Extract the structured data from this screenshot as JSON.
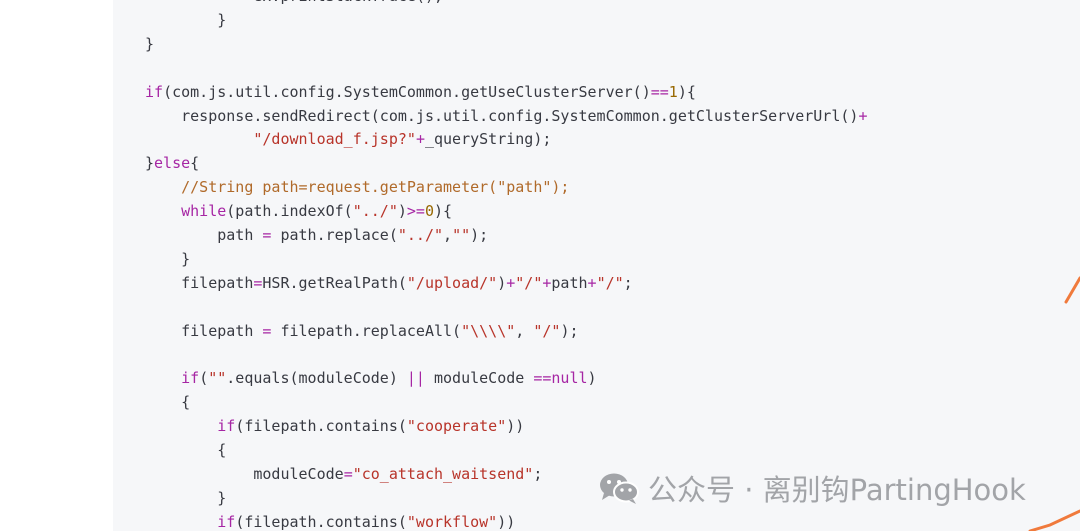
{
  "code": {
    "lines": [
      [
        {
          "t": "            ex.printStackTrace();",
          "k": "plain"
        }
      ],
      [
        {
          "t": "        }",
          "k": "plain"
        }
      ],
      [
        {
          "t": "}",
          "k": "plain"
        }
      ],
      [],
      [
        {
          "t": "if",
          "k": "keyword"
        },
        {
          "t": "(com.js.util.config.SystemCommon.getUseClusterServer()",
          "k": "plain"
        },
        {
          "t": "==",
          "k": "op"
        },
        {
          "t": "1",
          "k": "number"
        },
        {
          "t": "){",
          "k": "plain"
        }
      ],
      [
        {
          "t": "    response.sendRedirect(com.js.util.config.SystemCommon.getClusterServerUrl()",
          "k": "plain"
        },
        {
          "t": "+",
          "k": "op"
        }
      ],
      [
        {
          "t": "            ",
          "k": "plain"
        },
        {
          "t": "\"/download_f.jsp?\"",
          "k": "string"
        },
        {
          "t": "+",
          "k": "op"
        },
        {
          "t": "_queryString);",
          "k": "plain"
        }
      ],
      [
        {
          "t": "}",
          "k": "plain"
        },
        {
          "t": "else",
          "k": "keyword"
        },
        {
          "t": "{",
          "k": "plain"
        }
      ],
      [
        {
          "t": "    ",
          "k": "plain"
        },
        {
          "t": "//String path=request.getParameter(\"path\");",
          "k": "comment"
        }
      ],
      [
        {
          "t": "    ",
          "k": "plain"
        },
        {
          "t": "while",
          "k": "keyword"
        },
        {
          "t": "(path.indexOf(",
          "k": "plain"
        },
        {
          "t": "\"../\"",
          "k": "string"
        },
        {
          "t": ")",
          "k": "plain"
        },
        {
          "t": ">=",
          "k": "op"
        },
        {
          "t": "0",
          "k": "number"
        },
        {
          "t": "){",
          "k": "plain"
        }
      ],
      [
        {
          "t": "        path ",
          "k": "plain"
        },
        {
          "t": "=",
          "k": "op"
        },
        {
          "t": " path.replace(",
          "k": "plain"
        },
        {
          "t": "\"../\"",
          "k": "string"
        },
        {
          "t": ",",
          "k": "plain"
        },
        {
          "t": "\"\"",
          "k": "string"
        },
        {
          "t": ");",
          "k": "plain"
        }
      ],
      [
        {
          "t": "    }",
          "k": "plain"
        }
      ],
      [
        {
          "t": "    filepath",
          "k": "plain"
        },
        {
          "t": "=",
          "k": "op"
        },
        {
          "t": "HSR.getRealPath(",
          "k": "plain"
        },
        {
          "t": "\"/upload/\"",
          "k": "string"
        },
        {
          "t": ")",
          "k": "plain"
        },
        {
          "t": "+",
          "k": "op"
        },
        {
          "t": "\"/\"",
          "k": "string"
        },
        {
          "t": "+",
          "k": "op"
        },
        {
          "t": "path",
          "k": "plain"
        },
        {
          "t": "+",
          "k": "op"
        },
        {
          "t": "\"/\"",
          "k": "string"
        },
        {
          "t": ";",
          "k": "plain"
        }
      ],
      [],
      [
        {
          "t": "    filepath ",
          "k": "plain"
        },
        {
          "t": "=",
          "k": "op"
        },
        {
          "t": " filepath.replaceAll(",
          "k": "plain"
        },
        {
          "t": "\"\\\\\\\\\"",
          "k": "string"
        },
        {
          "t": ", ",
          "k": "plain"
        },
        {
          "t": "\"/\"",
          "k": "string"
        },
        {
          "t": ");",
          "k": "plain"
        }
      ],
      [],
      [
        {
          "t": "    ",
          "k": "plain"
        },
        {
          "t": "if",
          "k": "keyword"
        },
        {
          "t": "(",
          "k": "plain"
        },
        {
          "t": "\"\"",
          "k": "string"
        },
        {
          "t": ".equals(moduleCode) ",
          "k": "plain"
        },
        {
          "t": "||",
          "k": "op"
        },
        {
          "t": " moduleCode ",
          "k": "plain"
        },
        {
          "t": "==",
          "k": "op"
        },
        {
          "t": "null",
          "k": "keyword"
        },
        {
          "t": ")",
          "k": "plain"
        }
      ],
      [
        {
          "t": "    {",
          "k": "plain"
        }
      ],
      [
        {
          "t": "        ",
          "k": "plain"
        },
        {
          "t": "if",
          "k": "keyword"
        },
        {
          "t": "(filepath.contains(",
          "k": "plain"
        },
        {
          "t": "\"cooperate\"",
          "k": "string"
        },
        {
          "t": "))",
          "k": "plain"
        }
      ],
      [
        {
          "t": "        {",
          "k": "plain"
        }
      ],
      [
        {
          "t": "            moduleCode",
          "k": "plain"
        },
        {
          "t": "=",
          "k": "op"
        },
        {
          "t": "\"co_attach_waitsend\"",
          "k": "string"
        },
        {
          "t": ";",
          "k": "plain"
        }
      ],
      [
        {
          "t": "        }",
          "k": "plain"
        }
      ],
      [
        {
          "t": "        ",
          "k": "plain"
        },
        {
          "t": "if",
          "k": "keyword"
        },
        {
          "t": "(filepath.contains(",
          "k": "plain"
        },
        {
          "t": "\"workflow\"",
          "k": "string"
        },
        {
          "t": "))",
          "k": "plain"
        }
      ]
    ]
  },
  "watermark": {
    "text": "公众号 · 离别钩PartingHook",
    "icon": "wechat-icon"
  },
  "colors": {
    "background": "#ffffff",
    "code_background": "#f6f7f9",
    "keyword": "#a626a4",
    "string": "#b8342a",
    "number": "#986801",
    "comment": "#b06a2a",
    "plain": "#383a42",
    "watermark": "#a2a4a8",
    "accent_edge": "#f07a3c"
  }
}
